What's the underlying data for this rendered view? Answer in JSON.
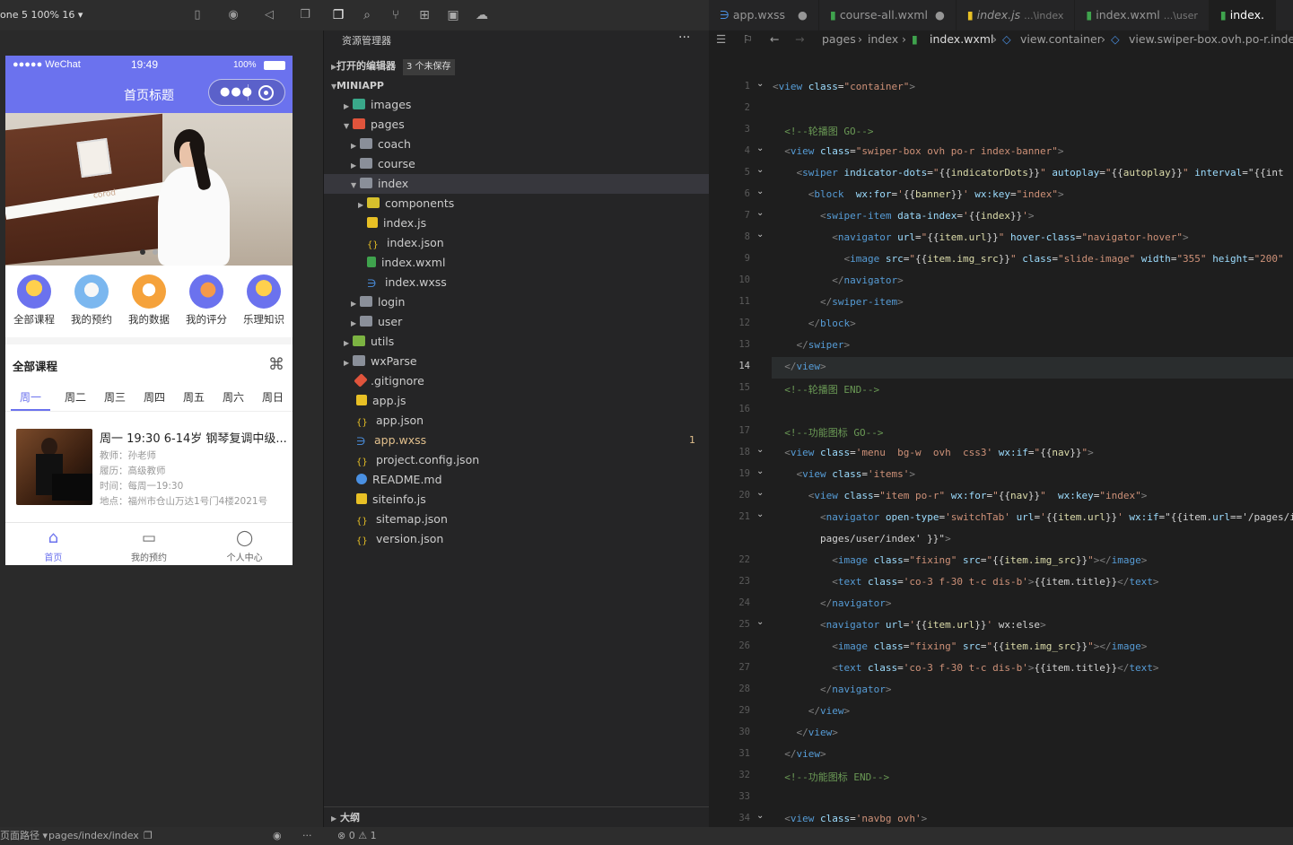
{
  "simulator": {
    "device_label": "one 5 100% 16 ▾",
    "status": {
      "carrier": "●●●●● WeChat",
      "time": "19:49",
      "battery": "100%"
    },
    "nav_title": "首页标题",
    "nav_items": [
      {
        "label": "全部课程"
      },
      {
        "label": "我的预约"
      },
      {
        "label": "我的数据"
      },
      {
        "label": "我的评分"
      },
      {
        "label": "乐理知识"
      }
    ],
    "section_title": "全部课程",
    "days": [
      "周一",
      "周二",
      "周三",
      "周四",
      "周五",
      "周六",
      "周日"
    ],
    "course": {
      "title": "周一 19:30 6-14岁 钢琴复调中级...",
      "teacher": "教师：孙老师",
      "record": "履历：高级教师",
      "time": "时间：每周一19:30",
      "place": "地点：福州市仓山万达1号门4楼2021号"
    },
    "tabs": [
      {
        "label": "首页"
      },
      {
        "label": "我的预约"
      },
      {
        "label": "个人中心"
      }
    ],
    "piano_brand": "corod"
  },
  "explorer": {
    "title": "资源管理器",
    "open_editors": "打开的编辑器",
    "unsaved_badge": "3 个未保存",
    "project": "MINIAPP",
    "rows": [
      {
        "label": "images"
      },
      {
        "label": "pages"
      },
      {
        "label": "coach"
      },
      {
        "label": "course"
      },
      {
        "label": "index"
      },
      {
        "label": "components"
      },
      {
        "label": "index.js"
      },
      {
        "label": "index.json"
      },
      {
        "label": "index.wxml"
      },
      {
        "label": "index.wxss"
      },
      {
        "label": "login"
      },
      {
        "label": "user"
      },
      {
        "label": "utils"
      },
      {
        "label": "wxParse"
      },
      {
        "label": ".gitignore"
      },
      {
        "label": "app.js"
      },
      {
        "label": "app.json"
      },
      {
        "label": "app.wxss",
        "badge": "1"
      },
      {
        "label": "project.config.json"
      },
      {
        "label": "README.md"
      },
      {
        "label": "siteinfo.js"
      },
      {
        "label": "sitemap.json"
      },
      {
        "label": "version.json"
      }
    ],
    "outline": "大纲"
  },
  "editor": {
    "tabs": [
      {
        "label": "app.wxss",
        "dim": ""
      },
      {
        "label": "course-all.wxml",
        "dim": ""
      },
      {
        "label": "index.js",
        "dim": "...\\index"
      },
      {
        "label": "index.wxml",
        "dim": "...\\user"
      },
      {
        "label": "index.",
        "dim": ""
      }
    ],
    "breadcrumb": [
      "pages",
      "index",
      "index.wxml",
      "view.container",
      "view.swiper-box.ovh.po-r.index-"
    ],
    "lines": [
      "<view class=\"container\">",
      "",
      "  <!--轮播图 GO-->",
      "  <view class=\"swiper-box ovh po-r index-banner\">",
      "    <swiper indicator-dots=\"{{indicatorDots}}\" autoplay=\"{{autoplay}}\" interval=\"{{int",
      "      <block  wx:for='{{banner}}' wx:key=\"index\">",
      "        <swiper-item data-index='{{index}}'>",
      "          <navigator url=\"{{item.url}}\" hover-class=\"navigator-hover\">",
      "            <image src=\"{{item.img_src}}\" class=\"slide-image\" width=\"355\" height=\"200\"",
      "          </navigator>",
      "        </swiper-item>",
      "      </block>",
      "    </swiper>",
      "  </view>",
      "  <!--轮播图 END-->",
      "",
      "  <!--功能图标 GO-->",
      "  <view class='menu  bg-w  ovh  css3' wx:if=\"{{nav}}\">",
      "    <view class='items'>",
      "      <view class=\"item po-r\" wx:for=\"{{nav}}\"  wx:key=\"index\">",
      "        <navigator open-type='switchTab' url='{{item.url}}' wx:if=\"{{item.url=='/pages/i",
      "        pages/user/index' }}\">",
      "          <image class=\"fixing\" src=\"{{item.img_src}}\"></image>",
      "          <text class='co-3 f-30 t-c dis-b'>{{item.title}}</text>",
      "        </navigator>",
      "        <navigator url='{{item.url}}' wx:else>",
      "          <image class=\"fixing\" src=\"{{item.img_src}}\"></image>",
      "          <text class='co-3 f-30 t-c dis-b'>{{item.title}}</text>",
      "        </navigator>",
      "      </view>",
      "    </view>",
      "  </view>",
      "  <!--功能图标 END-->",
      "",
      "  <view class='navbg ovh'>"
    ],
    "line_numbers": [
      "1",
      "2",
      "3",
      "4",
      "5",
      "6",
      "7",
      "8",
      "9",
      "10",
      "11",
      "12",
      "13",
      "14",
      "15",
      "16",
      "17",
      "18",
      "19",
      "20",
      "21",
      "",
      "22",
      "23",
      "24",
      "25",
      "26",
      "27",
      "28",
      "29",
      "30",
      "31",
      "32",
      "33",
      "34"
    ]
  },
  "status_bar": {
    "path_label": "页面路径 ▾",
    "path": "pages/index/index",
    "problems": "⊗ 0 ⚠ 1"
  }
}
